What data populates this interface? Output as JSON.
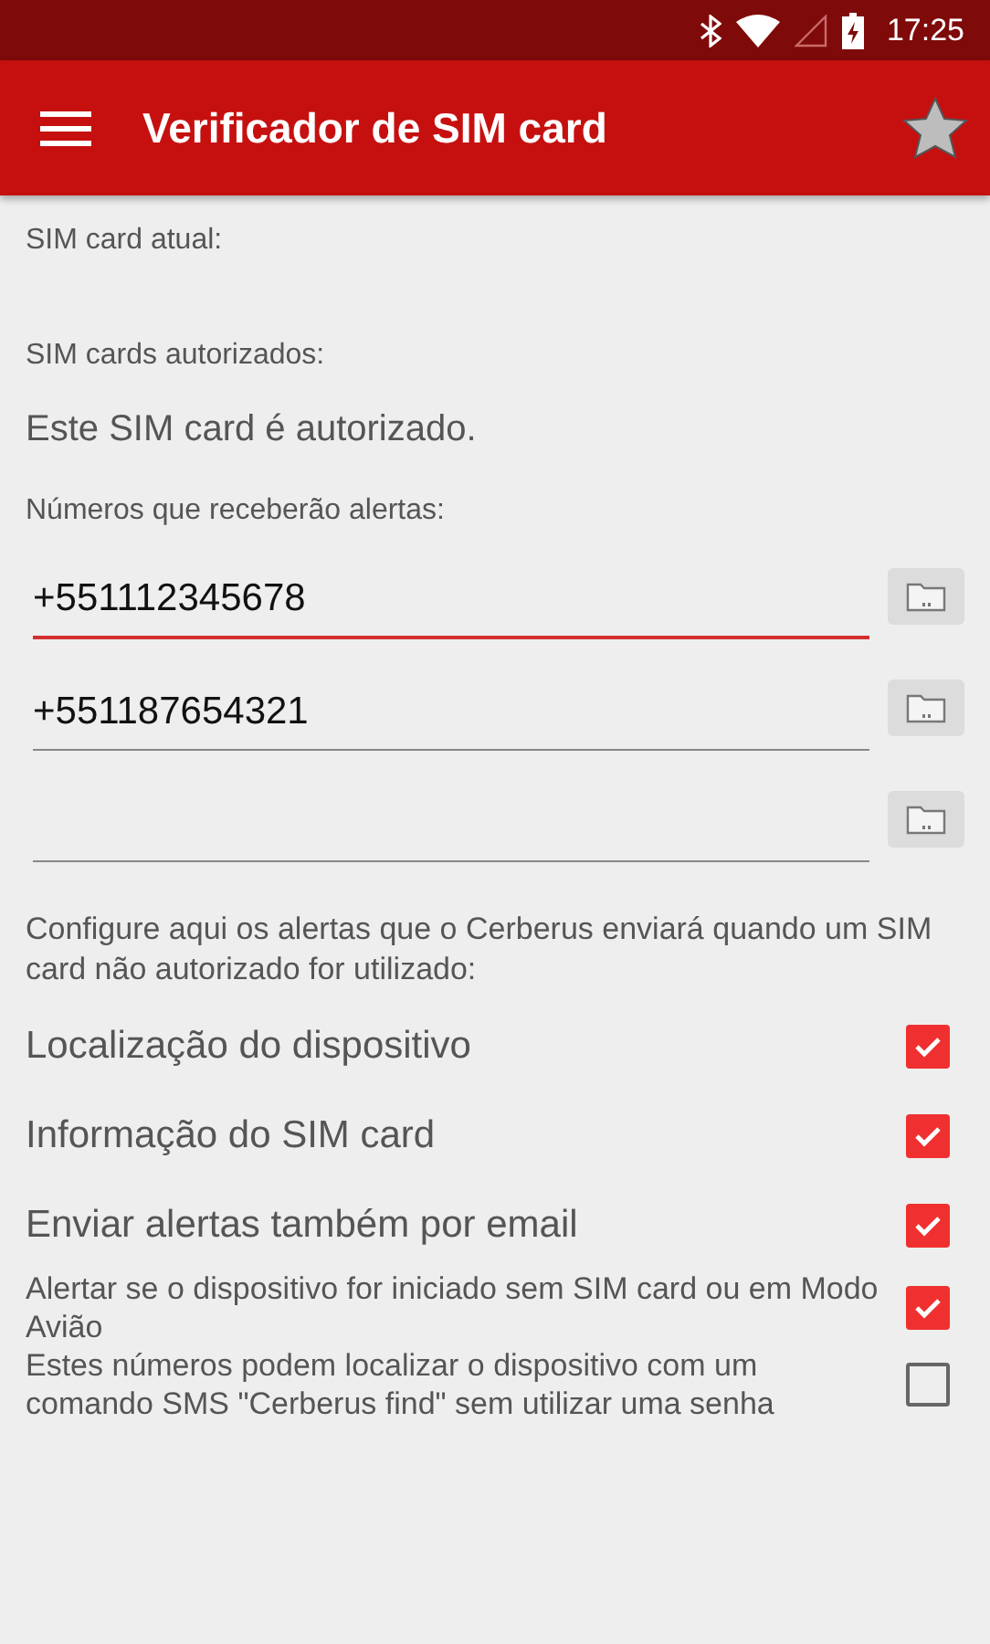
{
  "status_bar": {
    "time": "17:25"
  },
  "app_bar": {
    "title": "Verificador de SIM card",
    "favorite": false
  },
  "current_sim_label": "SIM card atual:",
  "authorized_label": "SIM cards autorizados:",
  "authorized_status": "Este SIM card é autorizado.",
  "numbers_label": "Números que receberão alertas:",
  "numbers": [
    {
      "value": "+551112345678",
      "focused": true
    },
    {
      "value": "+551187654321",
      "focused": false
    },
    {
      "focused": false
    }
  ],
  "alerts_intro": "Configure aqui os alertas que o Cerberus enviará quando um SIM card não autorizado for utilizado:",
  "options": [
    {
      "label": "Localização do dispositivo",
      "kind": "large",
      "checked": true
    },
    {
      "label": "Informação do SIM card",
      "kind": "large",
      "checked": true
    },
    {
      "label": "Enviar alertas também por email",
      "kind": "large",
      "checked": true
    },
    {
      "label": "Alertar se o dispositivo for iniciado sem SIM card ou em Modo Avião",
      "kind": "small",
      "checked": true
    },
    {
      "label": "Estes números podem localizar o dispositivo com um comando SMS \"Cerberus find\" sem utilizar uma senha",
      "kind": "small",
      "checked": false
    }
  ]
}
